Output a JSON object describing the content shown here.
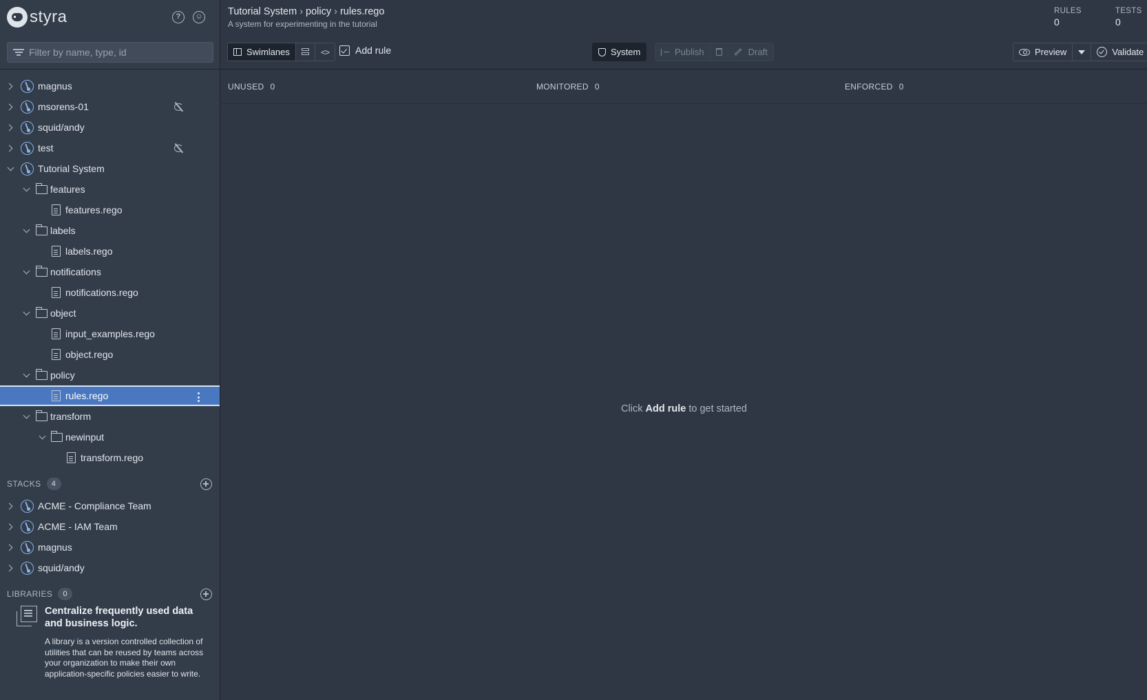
{
  "brand": {
    "name": "styra"
  },
  "filter": {
    "placeholder": "Filter by name, type, id"
  },
  "systems": [
    {
      "label": "magnus",
      "sync_off": false
    },
    {
      "label": "msorens-01",
      "sync_off": true
    },
    {
      "label": "squid/andy",
      "sync_off": false
    },
    {
      "label": "test",
      "sync_off": true
    },
    {
      "label": "Tutorial System",
      "expanded": true
    }
  ],
  "tutorial_tree": {
    "features": "features",
    "features_file": "features.rego",
    "labels": "labels",
    "labels_file": "labels.rego",
    "notifications": "notifications",
    "notifications_file": "notifications.rego",
    "object": "object",
    "object_file_1": "input_examples.rego",
    "object_file_2": "object.rego",
    "policy": "policy",
    "policy_file": "rules.rego",
    "transform": "transform",
    "newinput": "newinput",
    "transform_file": "transform.rego"
  },
  "stacks": {
    "title": "STACKS",
    "count": "4",
    "items": [
      "ACME - Compliance Team",
      "ACME - IAM Team",
      "magnus",
      "squid/andy"
    ]
  },
  "libraries": {
    "title": "LIBRARIES",
    "count": "0",
    "promo_title": "Centralize frequently used data and business logic.",
    "promo_desc": "A library is a version controlled collection of utilities that can be reused by teams across your organization to make their own application-specific policies easier to write."
  },
  "header": {
    "crumb_1": "Tutorial System",
    "crumb_2": "policy",
    "crumb_3": "rules.rego",
    "separator": "›",
    "subtitle": "A system for experimenting in the tutorial",
    "rules_label": "RULES",
    "rules_value": "0",
    "tests_label": "TESTS",
    "tests_value": "0"
  },
  "toolbar": {
    "swimlanes": "Swimlanes",
    "add_rule": "Add rule",
    "system": "System",
    "publish": "Publish",
    "draft": "Draft",
    "preview": "Preview",
    "validate": "Validate"
  },
  "lanes": {
    "unused_label": "UNUSED",
    "unused_count": "0",
    "monitored_label": "MONITORED",
    "monitored_count": "0",
    "enforced_label": "ENFORCED",
    "enforced_count": "0"
  },
  "empty_state": {
    "prefix": "Click",
    "action": "Add rule",
    "suffix": "to get started"
  },
  "colors": {
    "accent": "#4a78c0",
    "background": "#2f3744",
    "sidebar": "#333c49"
  }
}
